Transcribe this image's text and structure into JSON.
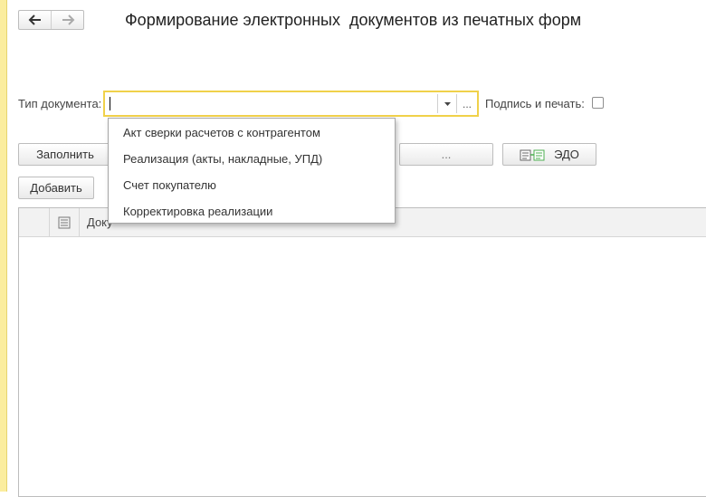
{
  "window": {
    "title": "Формирование электронных  документов из печатных форм"
  },
  "nav": {
    "back_icon": "arrow-left-icon",
    "forward_icon": "arrow-right-icon"
  },
  "form": {
    "doc_type_label": "Тип документа:",
    "doc_type_value": "",
    "select_button_label": "...",
    "sign_label": "Подпись и печать:",
    "sign_checked": false
  },
  "toolbar": {
    "fill_label": "Заполнить",
    "dots_label": "...",
    "edo_label": "ЭДО",
    "add_label": "Добавить"
  },
  "table": {
    "columns": [
      "Документ"
    ],
    "header_visible_text": "Доку"
  },
  "dropdown": {
    "items": [
      "Акт сверки расчетов с контрагентом",
      "Реализация (акты, накладные, УПД)",
      "Счет покупателю",
      "Корректировка реализации"
    ]
  },
  "colors": {
    "accent_yellow": "#f0d14a",
    "strip_yellow": "#fbed9e",
    "edo_green": "#4caf50"
  }
}
